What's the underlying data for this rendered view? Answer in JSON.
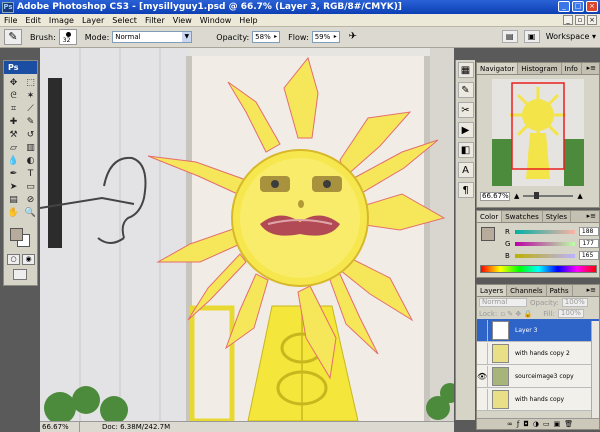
{
  "window": {
    "title": "Adobe Photoshop CS3 - [mysillyguy1.psd @ 66.7% (Layer 3, RGB/8#/CMYK)]",
    "ps_logo": "Ps"
  },
  "menu": [
    "File",
    "Edit",
    "Image",
    "Layer",
    "Select",
    "Filter",
    "View",
    "Window",
    "Help"
  ],
  "options": {
    "brush_label": "Brush:",
    "brush_size": "32",
    "mode_label": "Mode:",
    "mode_value": "Normal",
    "opacity_label": "Opacity:",
    "opacity_value": "58%",
    "flow_label": "Flow:",
    "flow_value": "59%",
    "workspace_label": "Workspace"
  },
  "toolbox": {
    "badge": "Ps"
  },
  "status": {
    "zoom": "66.67%",
    "doc": "Doc: 6.38M/242.7M"
  },
  "navigator": {
    "tabs": [
      "Navigator",
      "Histogram",
      "Info"
    ],
    "zoom": "66.67%"
  },
  "color": {
    "tabs": [
      "Color",
      "Swatches",
      "Styles"
    ],
    "r_label": "R",
    "r_value": "188",
    "g_label": "G",
    "g_value": "177",
    "b_label": "B",
    "b_value": "165"
  },
  "layers": {
    "tabs": [
      "Layers",
      "Channels",
      "Paths"
    ],
    "blend": "Normal",
    "opacity_label": "Opacity:",
    "opacity_value": "100%",
    "lock_label": "Lock:",
    "fill_label": "Fill:",
    "fill_value": "100%",
    "items": [
      {
        "name": "Layer 3",
        "selected": true
      },
      {
        "name": "with hands copy 2",
        "selected": false
      },
      {
        "name": "sourceimage3 copy",
        "selected": false
      },
      {
        "name": "with hands copy",
        "selected": false
      }
    ]
  },
  "colors": {
    "accent": "#2e63c8",
    "sun_yellow": "#f3e44a",
    "foreground": "#b7ac9c"
  }
}
